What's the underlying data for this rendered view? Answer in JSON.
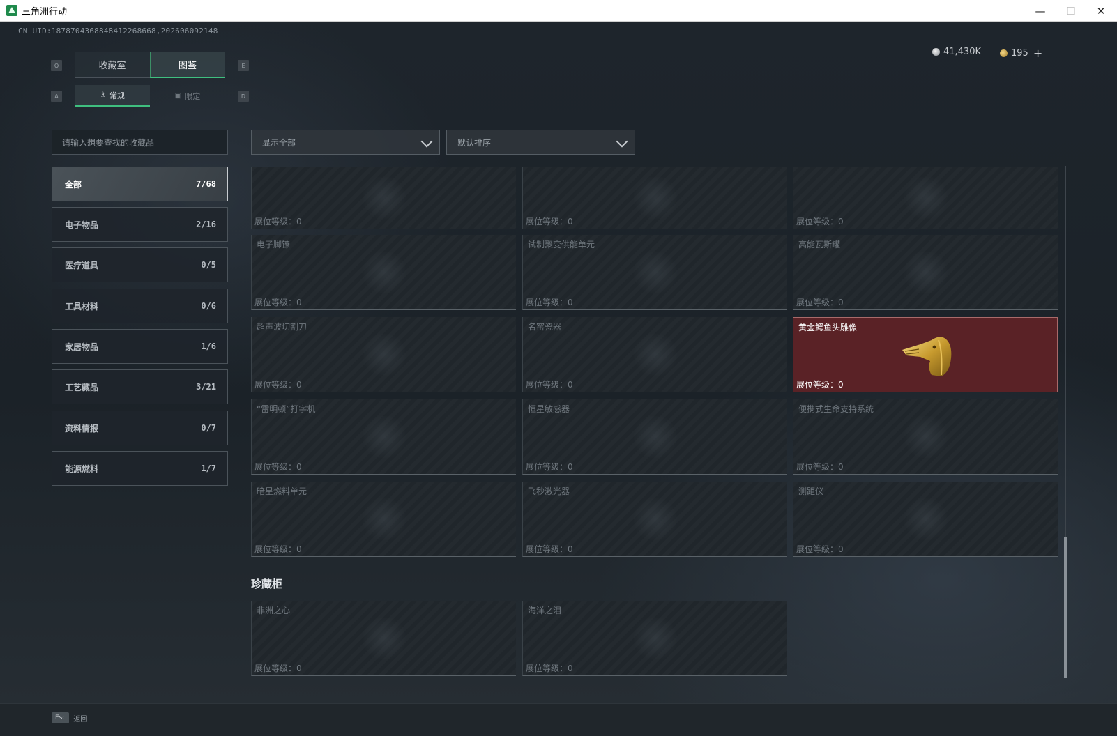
{
  "window": {
    "title": "三角洲行动",
    "minimize": "—",
    "maximize": "☐",
    "close": "✕"
  },
  "header": {
    "uid": "CN UID:1878704368848412268668,202606092148",
    "silver_amount": "41,430K",
    "gold_amount": "195",
    "plus": "+"
  },
  "tabs": {
    "left_key": "Q",
    "right_key": "E",
    "items": [
      {
        "label": "收藏室",
        "active": false
      },
      {
        "label": "图鉴",
        "active": true
      }
    ]
  },
  "subtabs": {
    "left_key": "A",
    "right_key": "D",
    "items": [
      {
        "label": "常规",
        "icon": "♗",
        "active": true
      },
      {
        "label": "限定",
        "icon": "▣",
        "active": false
      }
    ]
  },
  "search": {
    "placeholder": "请输入想要查找的收藏品"
  },
  "filters": {
    "show": "显示全部",
    "sort": "默认排序"
  },
  "categories": [
    {
      "label": "全部",
      "count": "7/68"
    },
    {
      "label": "电子物品",
      "count": "2/16"
    },
    {
      "label": "医疗道具",
      "count": "0/5"
    },
    {
      "label": "工具材料",
      "count": "0/6"
    },
    {
      "label": "家居物品",
      "count": "1/6"
    },
    {
      "label": "工艺藏品",
      "count": "3/21"
    },
    {
      "label": "资料情报",
      "count": "0/7"
    },
    {
      "label": "能源燃料",
      "count": "1/7"
    }
  ],
  "level_label": "展位等级：",
  "level_value": "0",
  "items": [
    {
      "name": "",
      "level": "0"
    },
    {
      "name": "",
      "level": "0"
    },
    {
      "name": "",
      "level": "0"
    },
    {
      "name": "电子脚镣",
      "level": "0"
    },
    {
      "name": "试制聚变供能单元",
      "level": "0"
    },
    {
      "name": "高能瓦斯罐",
      "level": "0"
    },
    {
      "name": "超声波切割刀",
      "level": "0"
    },
    {
      "name": "名窑瓷器",
      "level": "0"
    },
    {
      "name": "黄金鳄鱼头雕像",
      "level": "0",
      "owned": true
    },
    {
      "name": "“雷明顿”打字机",
      "level": "0"
    },
    {
      "name": "恒星敏感器",
      "level": "0"
    },
    {
      "name": "便携式生命支持系统",
      "level": "0"
    },
    {
      "name": "暗星燃料单元",
      "level": "0"
    },
    {
      "name": "飞秒激光器",
      "level": "0"
    },
    {
      "name": "测距仪",
      "level": "0"
    }
  ],
  "cabinet": {
    "title": "珍藏柜",
    "items": [
      {
        "name": "非洲之心",
        "level": "0"
      },
      {
        "name": "海洋之泪",
        "level": "0"
      }
    ]
  },
  "footer": {
    "esc_key": "Esc",
    "back_label": "返回"
  },
  "colors": {
    "accent": "#3fbf7f",
    "owned_bg": "#5a2226"
  }
}
